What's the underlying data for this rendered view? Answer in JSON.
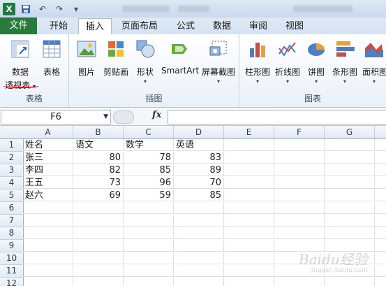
{
  "ribbon_tabs": {
    "file": "文件",
    "home": "开始",
    "insert": "插入",
    "page_layout": "页面布局",
    "formulas": "公式",
    "data": "数据",
    "review": "审阅",
    "view": "视图"
  },
  "ribbon": {
    "tables_group": {
      "label": "表格",
      "pivot_line1": "数据",
      "pivot_line2": "透视表",
      "table": "表格"
    },
    "illustrations_group": {
      "label": "插图",
      "picture": "图片",
      "clipart": "剪贴画",
      "shapes": "形状",
      "smartart": "SmartArt",
      "screenshot": "屏幕截图"
    },
    "charts_group": {
      "label": "图表",
      "column": "柱形图",
      "line": "折线图",
      "pie": "饼图",
      "bar": "条形图",
      "area": "面积图"
    }
  },
  "formula_bar": {
    "name_box": "F6",
    "fx": "fx",
    "formula": ""
  },
  "sheet": {
    "columns": [
      "A",
      "B",
      "C",
      "D",
      "E",
      "F",
      "G"
    ],
    "rows": [
      "1",
      "2",
      "3",
      "4",
      "5",
      "6",
      "7",
      "8",
      "9",
      "10",
      "11",
      "12"
    ],
    "cells": [
      [
        "姓名",
        "语文",
        "数学",
        "英语"
      ],
      [
        "张三",
        "80",
        "78",
        "83"
      ],
      [
        "李四",
        "82",
        "85",
        "89"
      ],
      [
        "王五",
        "73",
        "96",
        "70"
      ],
      [
        "赵六",
        "69",
        "59",
        "85"
      ]
    ]
  },
  "watermark": {
    "main": "Baidu经验",
    "sub": "jingyan.baidu.com"
  },
  "colors": {
    "file_tab": "#2a7a3c",
    "annotation_red": "#dd1111",
    "accent": "#1f7a3d"
  }
}
